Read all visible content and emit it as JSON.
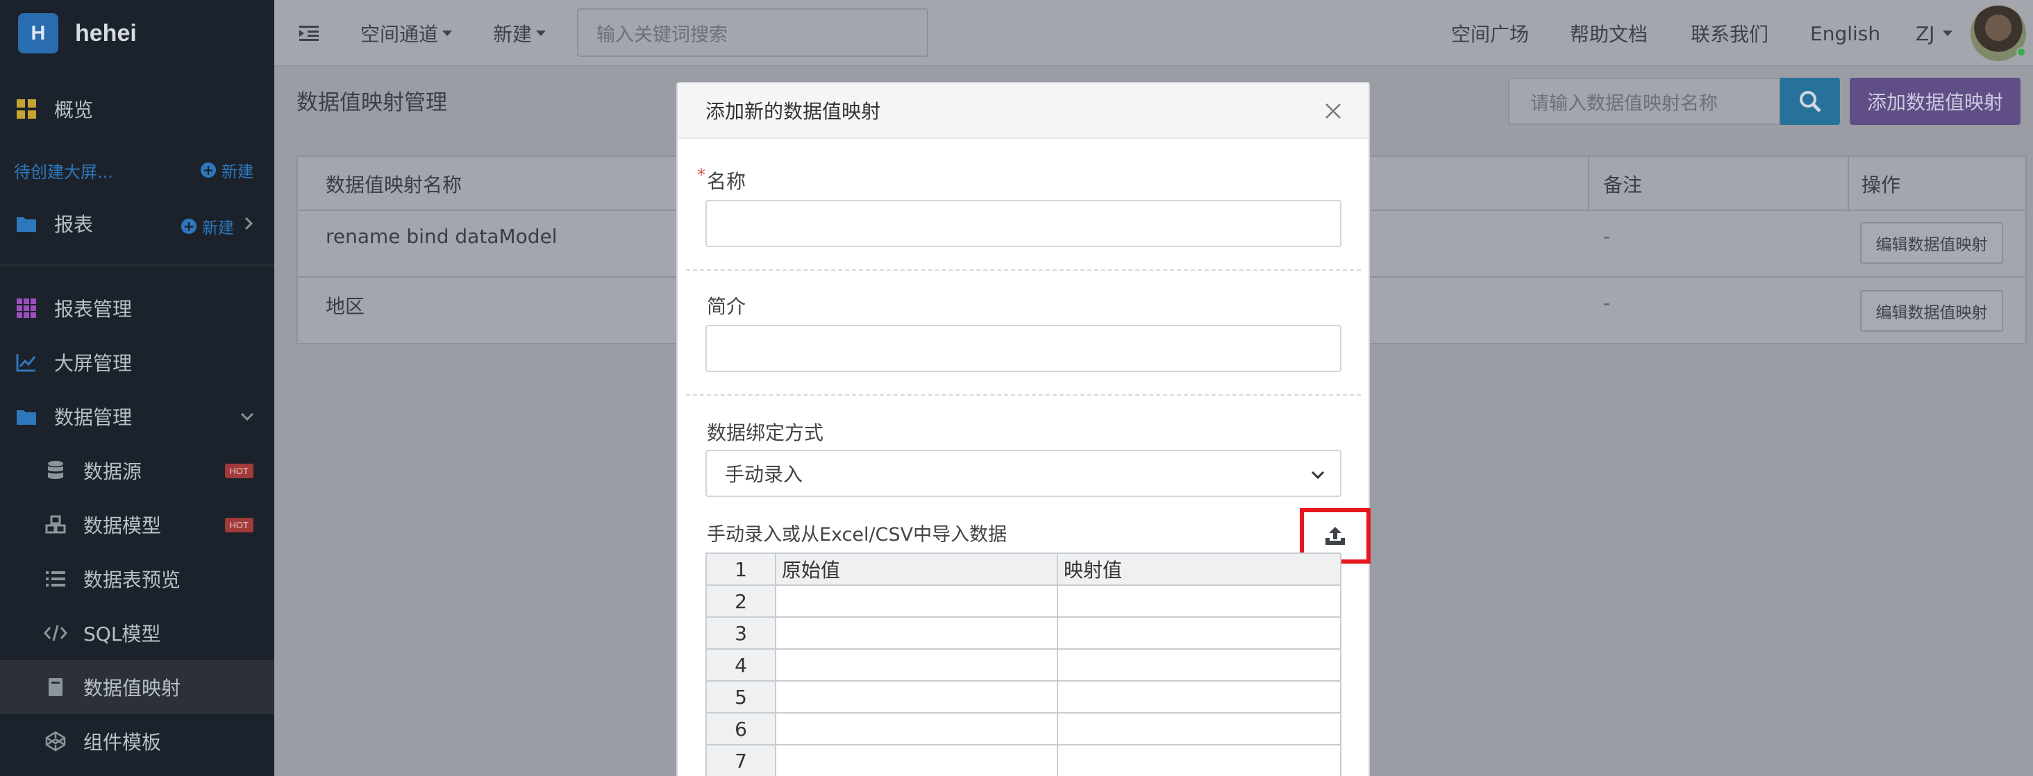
{
  "brand": {
    "logo_letter": "H",
    "name": "hehei"
  },
  "sidebar": {
    "overview": "概览",
    "pending": "待创建大屏...",
    "new_label": "新建",
    "reports": "报表",
    "items": [
      {
        "label": "报表管理",
        "icon": "grid-icon"
      },
      {
        "label": "大屏管理",
        "icon": "chart-line-icon"
      },
      {
        "label": "数据管理",
        "icon": "folder-icon"
      }
    ],
    "sub_items": [
      {
        "label": "数据源",
        "badge": "HOT",
        "icon": "database-icon"
      },
      {
        "label": "数据模型",
        "badge": "HOT",
        "icon": "cubes-icon"
      },
      {
        "label": "数据表预览",
        "icon": "list-icon"
      },
      {
        "label": "SQL模型",
        "icon": "code-icon"
      },
      {
        "label": "数据值映射",
        "icon": "book-icon",
        "active": true
      },
      {
        "label": "组件模板",
        "icon": "codepen-icon"
      }
    ]
  },
  "topbar": {
    "space_channel": "空间通道",
    "new": "新建",
    "search_placeholder": "输入关键词搜索",
    "plaza": "空间广场",
    "help": "帮助文档",
    "contact": "联系我们",
    "lang": "English",
    "user": "ZJ"
  },
  "page": {
    "title": "数据值映射管理",
    "search_placeholder": "请输入数据值映射名称",
    "add_button": "添加数据值映射",
    "columns": {
      "name": "数据值映射名称",
      "note": "备注",
      "action": "操作"
    },
    "rows": [
      {
        "name": "rename bind dataModel",
        "note": "-",
        "action": "编辑数据值映射"
      },
      {
        "name": "地区",
        "note": "-",
        "action": "编辑数据值映射"
      }
    ]
  },
  "modal": {
    "title": "添加新的数据值映射",
    "name_label": "名称",
    "desc_label": "简介",
    "bind_label": "数据绑定方式",
    "bind_value": "手动录入",
    "import_label": "手动录入或从Excel/CSV中导入数据",
    "grid": {
      "headers": [
        "原始值",
        "映射值"
      ],
      "row_numbers": [
        "1",
        "2",
        "3",
        "4",
        "5",
        "6",
        "7"
      ]
    }
  },
  "colors": {
    "sidebar_bg": "#1c222b",
    "accent_blue": "#2d78bd",
    "search_btn": "#27729a",
    "add_btn": "#5f4f86",
    "highlight_red": "#e8171e"
  }
}
